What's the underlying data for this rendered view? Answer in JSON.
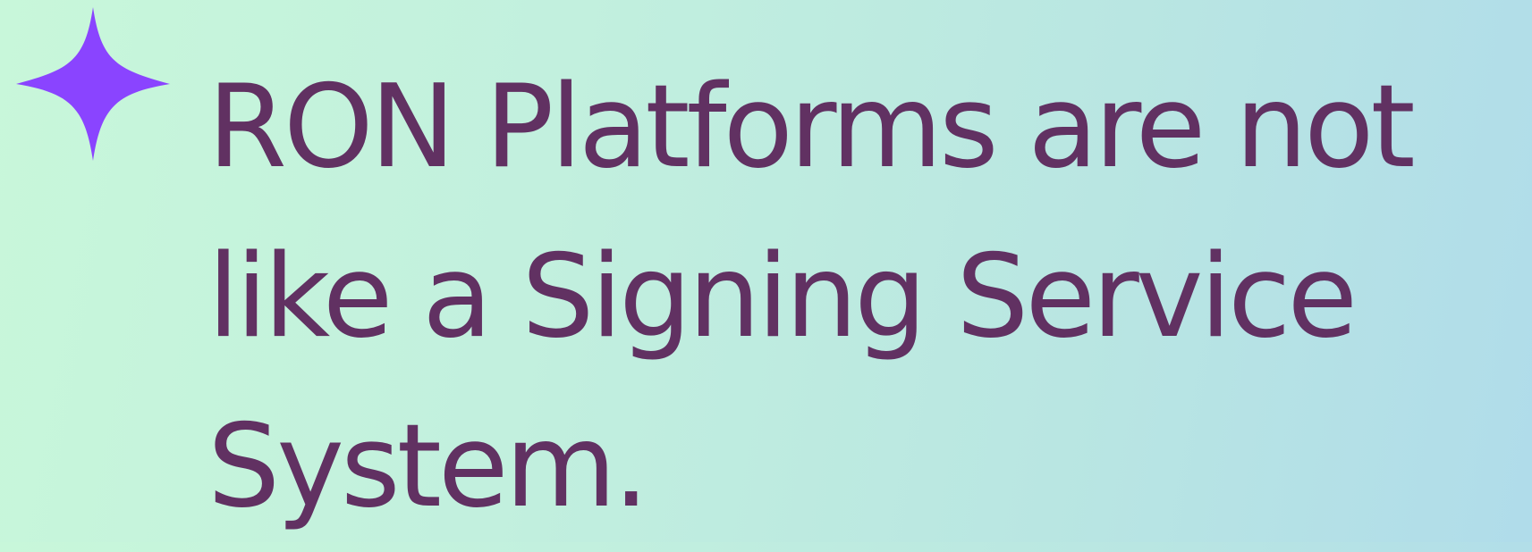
{
  "slide": {
    "headline": "RON Platforms are not like a Signing Service System.",
    "icon": "sparkle-icon"
  },
  "colors": {
    "text": "#613162",
    "sparkle": "#8a44ff",
    "background_start": "#c8f7da",
    "background_end": "#b0dcea"
  }
}
